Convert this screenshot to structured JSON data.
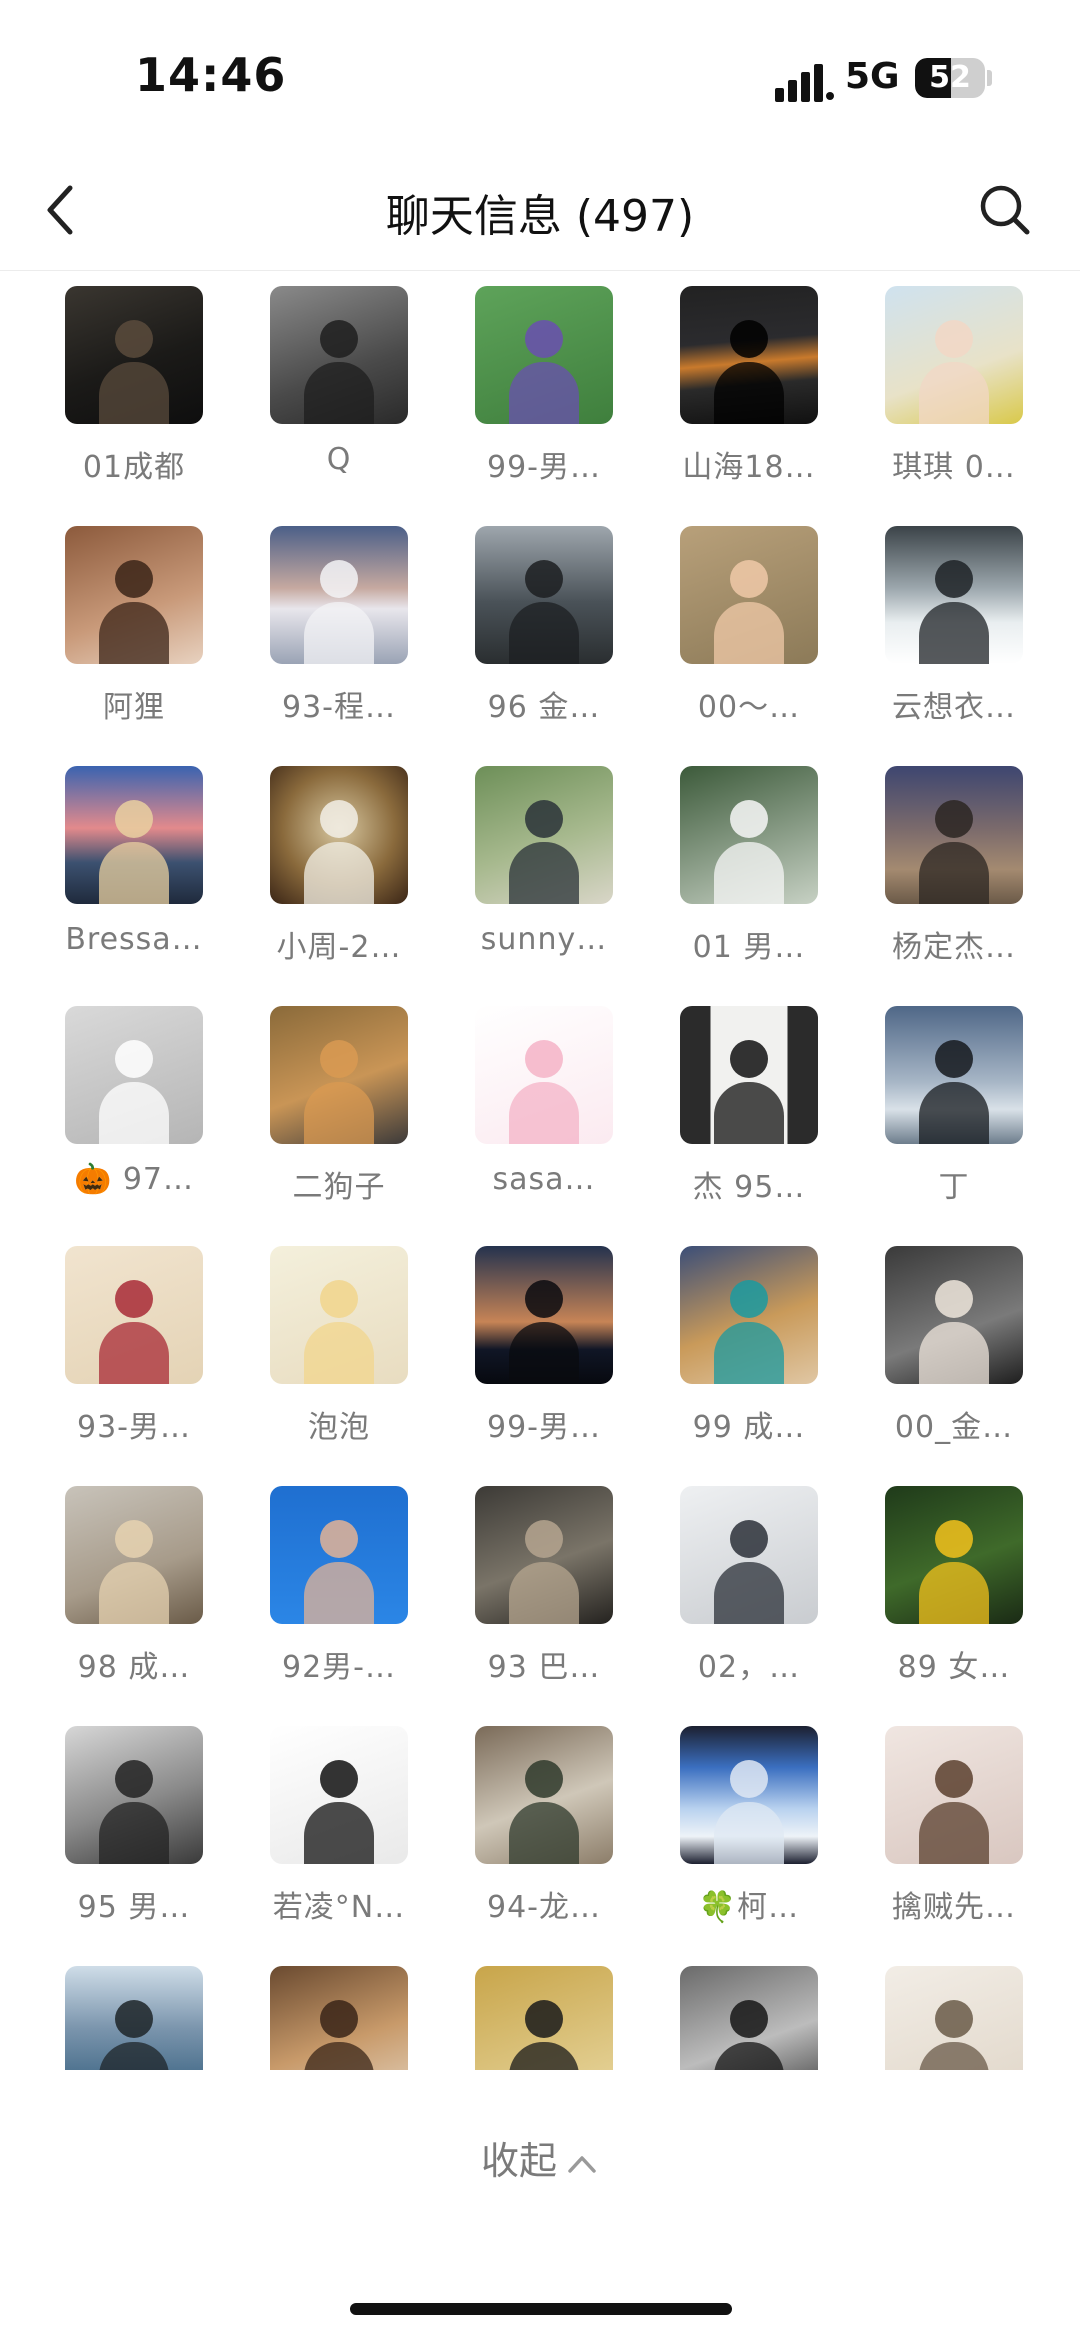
{
  "status_bar": {
    "time": "14:46",
    "network": "5G",
    "battery": "52",
    "battery_level": 0.52
  },
  "nav": {
    "title": "聊天信息 (497)",
    "back_icon": "chevron-left-icon",
    "search_icon": "search-icon"
  },
  "members": [
    {
      "name": "01成都",
      "bg": "linear-gradient(160deg,#3a3630,#1b1a18 55%,#0e0e0e)",
      "fig": "#5a4b3c"
    },
    {
      "name": "Q",
      "bg": "linear-gradient(160deg,#8a8a8a,#4a4a4a 60%,#2a2a2a)",
      "fig": "#1e1e1e"
    },
    {
      "name": "99-男…",
      "bg": "linear-gradient(160deg,#5ea35a,#3f7f3d)",
      "fig": "#6a4fb0"
    },
    {
      "name": "山海18…",
      "bg": "linear-gradient(175deg,#222 0%,#2b2b2e 40%,#c97a2c 55%,#2a2a2a 70%,#111 100%)",
      "fig": "#000000"
    },
    {
      "name": "琪琪 0…",
      "bg": "linear-gradient(160deg,#cfe2ef,#e8e2c8 60%,#d9c94a)",
      "fig": "#f2d7c6"
    },
    {
      "name": "阿狸",
      "bg": "linear-gradient(160deg,#8c5a3c,#c99a7a 60%,#e8d2c0)",
      "fig": "#3b2418"
    },
    {
      "name": "93-程…",
      "bg": "linear-gradient(180deg,#4b5f88 0%,#c6a9a0 45%,#e8e6ec 60%,#9aa3b5 100%)",
      "fig": "#f3f3f6"
    },
    {
      "name": "96 金…",
      "bg": "linear-gradient(180deg,#9ea6ad,#4a5258 55%,#2a2e30)",
      "fig": "#1c1f21"
    },
    {
      "name": "00～…",
      "bg": "linear-gradient(160deg,#b8a07a,#8c7a58)",
      "fig": "#f0c9a8"
    },
    {
      "name": "云想衣…",
      "bg": "linear-gradient(180deg,#3b4348 0%,#9ca7ad 45%,#e9eef0 70%,#ffffff 100%)",
      "fig": "#1d2226"
    },
    {
      "name": "Bressa…",
      "bg": "linear-gradient(180deg,#3a63b0 0%,#e38a8c 45%,#3c5170 70%,#1f2a3c 100%)",
      "fig": "#e9d0a0"
    },
    {
      "name": "小周-2…",
      "bg": "radial-gradient(circle at 50% 45%,#d7c7a0,#8a6a3c 55%,#3a2516)",
      "fig": "#f2efe6"
    },
    {
      "name": "sunny…",
      "bg": "linear-gradient(160deg,#6d8f58,#a7b98e 55%,#d9d6c8)",
      "fig": "#2a3238"
    },
    {
      "name": "01 男…",
      "bg": "linear-gradient(160deg,#3c5a3a,#c7d1c4)",
      "fig": "#f7f7f7"
    },
    {
      "name": "杨定杰…",
      "bg": "linear-gradient(180deg,#3e4670 0%,#7a6a6c 45%,#a48a70 75%,#6b5a48 100%)",
      "fig": "#2b2622"
    },
    {
      "name": "🎃 97…",
      "bg": "linear-gradient(160deg,#d9d9d9,#b5b5b5)",
      "fig": "#ffffff"
    },
    {
      "name": "二狗子",
      "bg": "linear-gradient(160deg,#8a6a3a,#c99556 55%,#3c3a3a)",
      "fig": "#d99a52"
    },
    {
      "name": "sasa…",
      "bg": "linear-gradient(160deg,#ffffff,#fbeaf0)",
      "fig": "#f4b3c7"
    },
    {
      "name": "杰 95…",
      "bg": "linear-gradient(90deg,#2b2b2b 0 22%,#f1f1ef 22% 78%,#2b2b2b 78%)",
      "fig": "#111111"
    },
    {
      "name": "丁",
      "bg": "linear-gradient(180deg,#4f6787 0%,#a7b6c6 55%,#d9e1e8 75%,#6d7d8c 100%)",
      "fig": "#15191d"
    },
    {
      "name": "93-男…",
      "bg": "linear-gradient(160deg,#f1e4cf,#e4d3b5)",
      "fig": "#a82a36"
    },
    {
      "name": "泡泡",
      "bg": "linear-gradient(160deg,#f4f0dc,#e8dcc0)",
      "fig": "#f1d58c"
    },
    {
      "name": "99-男…",
      "bg": "linear-gradient(180deg,#24324e 0%,#c78456 55%,#101626 75%,#07090f 100%)",
      "fig": "#0a0b0f"
    },
    {
      "name": "99 成…",
      "bg": "linear-gradient(160deg,#3b4e78,#c99a5a 55%,#e0c7a4)",
      "fig": "#1a9aa0"
    },
    {
      "name": "00_金…",
      "bg": "linear-gradient(160deg,#3a3a3a,#7a7a7a 60%,#1e1e1e)",
      "fig": "#efe6dc"
    },
    {
      "name": "98 成…",
      "bg": "linear-gradient(160deg,#c8c3ba,#a79b8a 60%,#6a5b48)",
      "fig": "#e6d2b0"
    },
    {
      "name": "92男-…",
      "bg": "linear-gradient(180deg,#1f6fd0,#2b86e6)",
      "fig": "#e3b395"
    },
    {
      "name": "93 巴…",
      "bg": "linear-gradient(160deg,#3c3a36,#7a7468 55%,#24221f)",
      "fig": "#b5a58f"
    },
    {
      "name": "02，…",
      "bg": "linear-gradient(160deg,#eef0f2,#c9ccd0)",
      "fig": "#2b3038"
    },
    {
      "name": "89 女…",
      "bg": "linear-gradient(160deg,#1f3a1a,#3f6a2a 55%,#1a2a15)",
      "fig": "#f3c21c"
    },
    {
      "name": "95 男…",
      "bg": "linear-gradient(160deg,#d7d7d7,#8a8a8a 55%,#3a3a3a)",
      "fig": "#222222"
    },
    {
      "name": "若凌°N…",
      "bg": "linear-gradient(160deg,#ffffff,#e9e9e9)",
      "fig": "#111111"
    },
    {
      "name": "94-龙…",
      "bg": "linear-gradient(160deg,#7a6a58,#cfc7b8 55%,#8c7d69)",
      "fig": "#2f3a2c"
    },
    {
      "name": "🍀柯…",
      "bg": "linear-gradient(180deg,#1c2030 0%,#3b6fc0 30%,#b9d2ef 60%,#eef3f8 80%,#1c2030 100%)",
      "fig": "#dfe8f3"
    },
    {
      "name": "擒贼先…",
      "bg": "linear-gradient(160deg,#f0e6e1,#d9c7c0)",
      "fig": "#5a3f2e"
    },
    {
      "name": "",
      "bg": "linear-gradient(180deg,#cfdde8 0%,#7b95ad 45%,#2f5a7a 100%)",
      "fig": "#1d2428"
    },
    {
      "name": "",
      "bg": "linear-gradient(160deg,#6a4a30,#c89a6a 55%,#e2d1bc)",
      "fig": "#3a2518"
    },
    {
      "name": "",
      "bg": "linear-gradient(160deg,#c8a54a,#e8d7a0)",
      "fig": "#1a1a1a"
    },
    {
      "name": "",
      "bg": "linear-gradient(160deg,#6a6a6a,#bcbcbc 55%,#3a3a3a)",
      "fig": "#161616"
    },
    {
      "name": "",
      "bg": "linear-gradient(160deg,#f2ede6,#e0d6c8)",
      "fig": "#6a5a48"
    }
  ],
  "footer": {
    "collapse_label": "收起",
    "collapse_icon": "chevron-up-icon"
  }
}
